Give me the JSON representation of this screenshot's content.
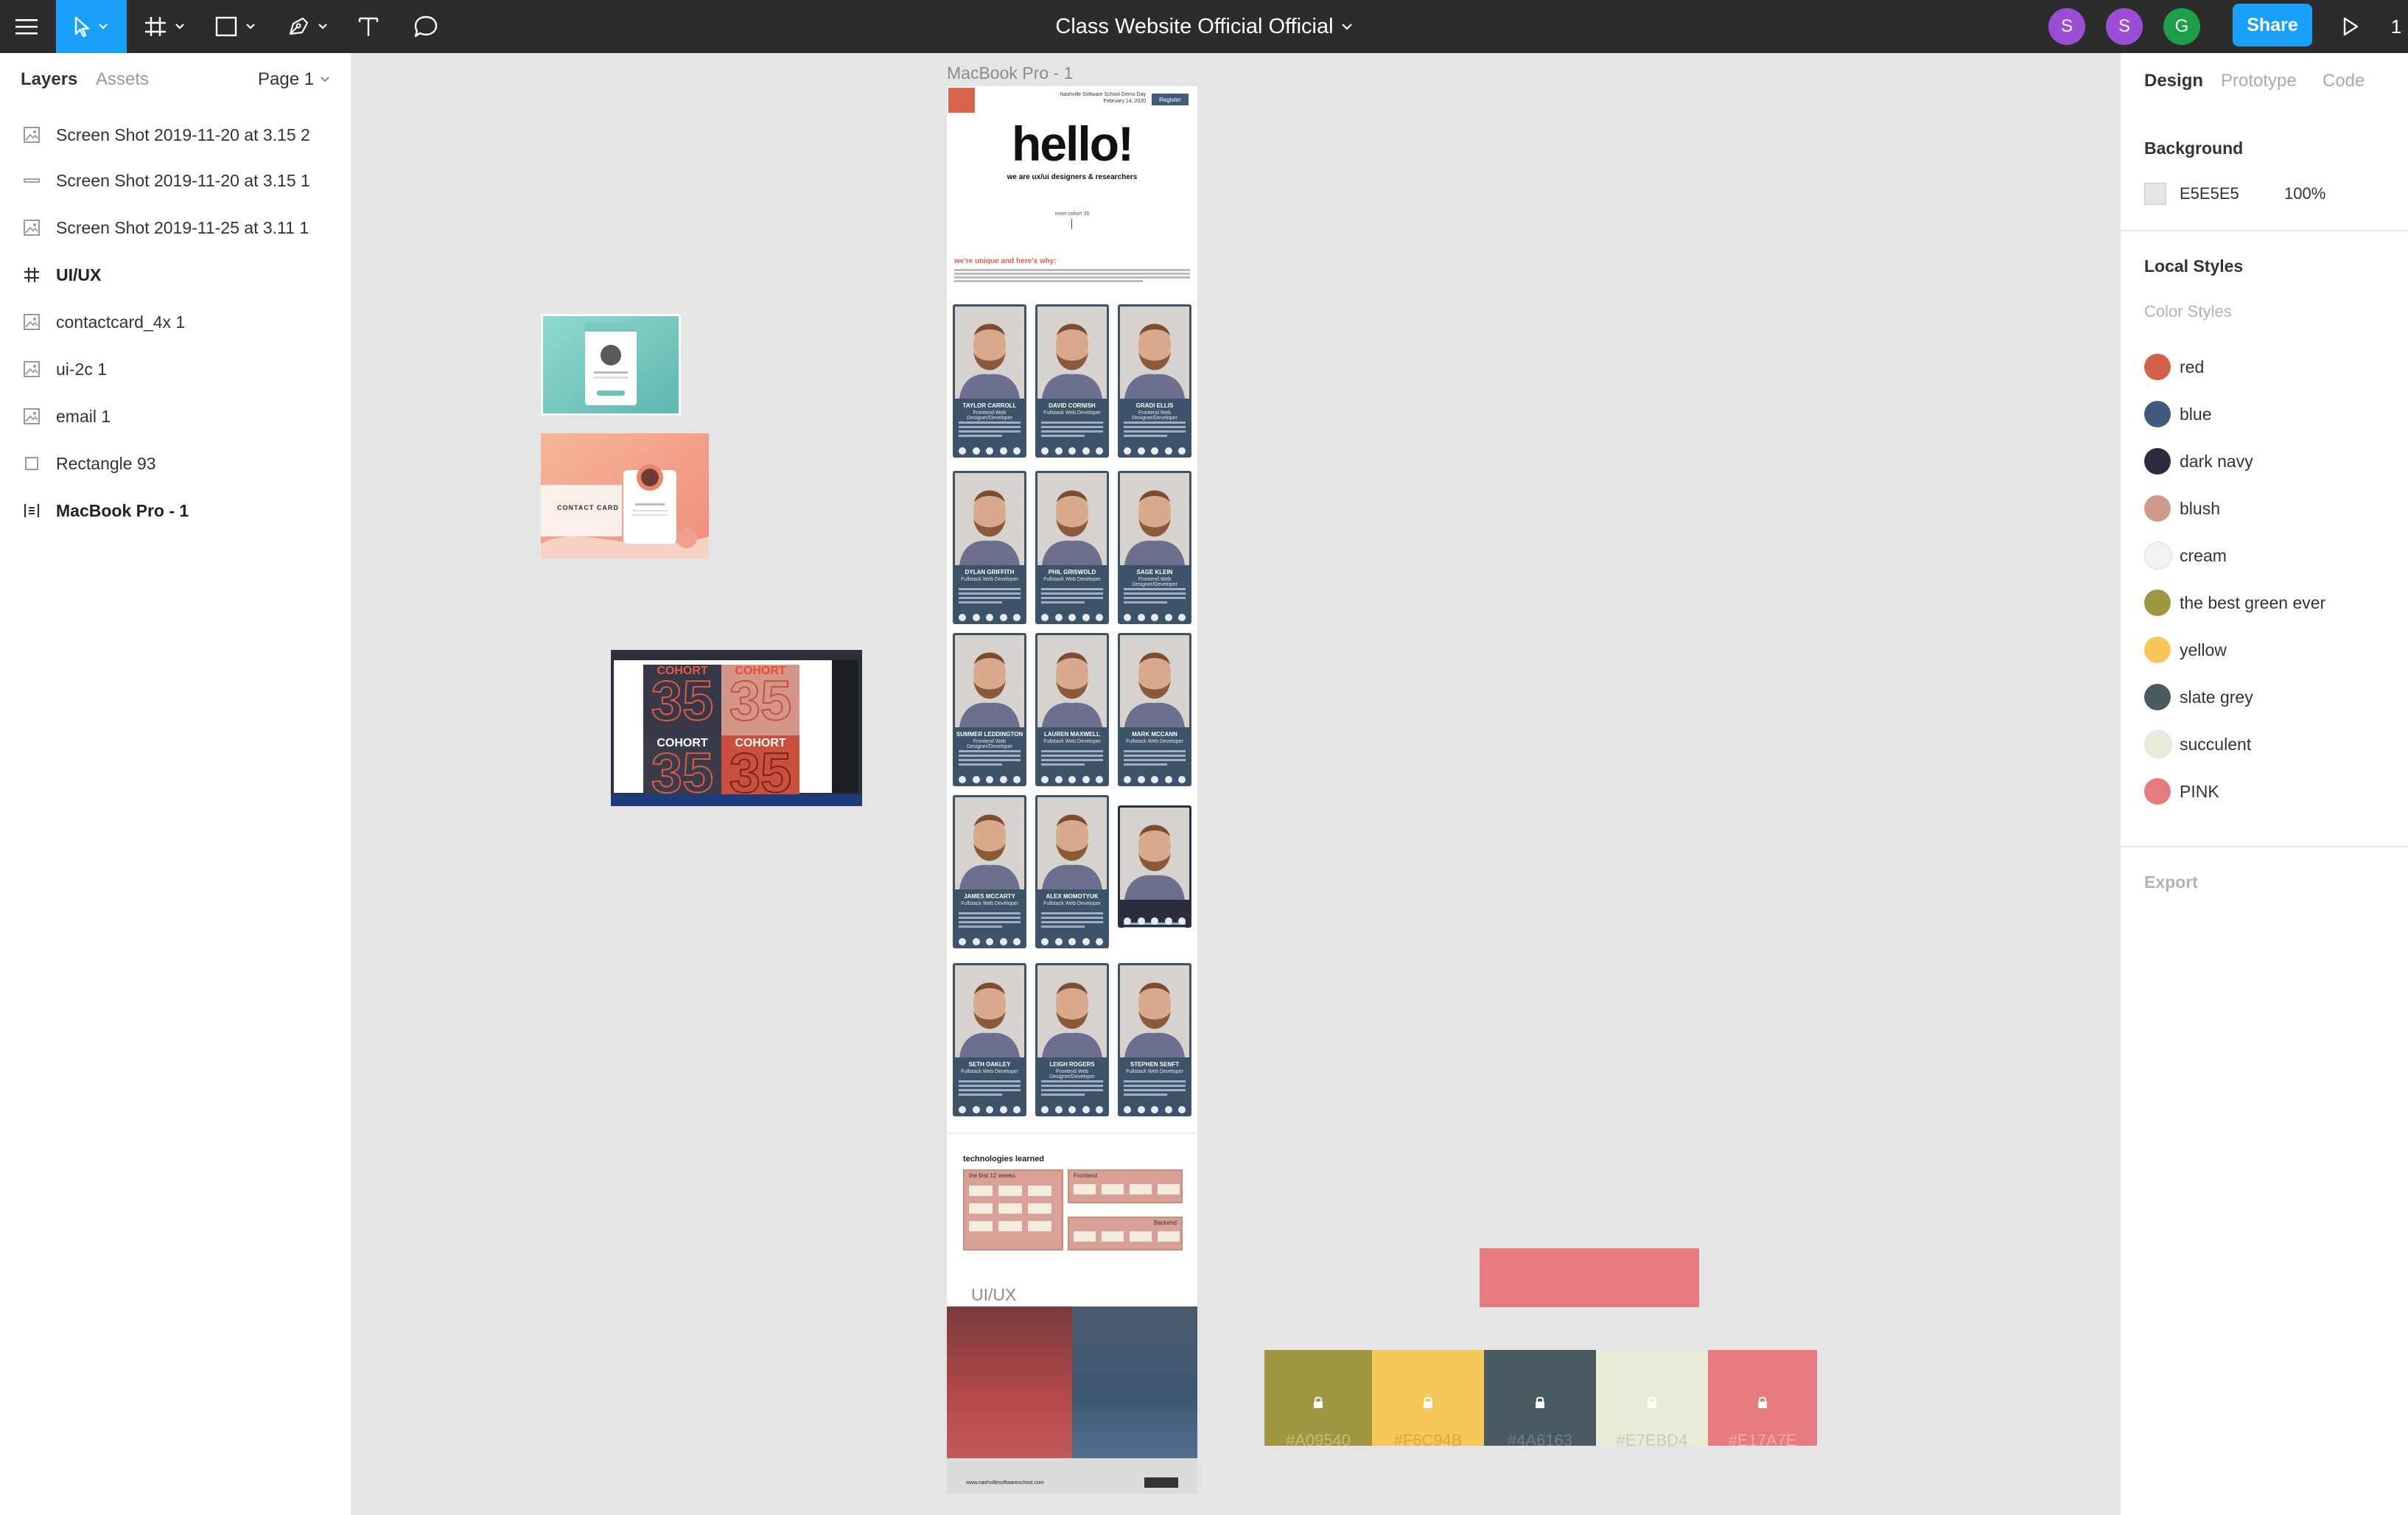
{
  "toolbar": {
    "menu_icon": "hamburger-icon",
    "tools": [
      "move-tool-icon",
      "frame-tool-icon",
      "shape-tool-icon",
      "pen-tool-icon",
      "text-tool-icon",
      "comment-tool-icon"
    ],
    "file_title": "Class Website Official Official",
    "avatars": [
      {
        "initial": "S",
        "color": "#9b4dd6"
      },
      {
        "initial": "S",
        "color": "#9b4dd6"
      },
      {
        "initial": "G",
        "color": "#1f9e4a"
      }
    ],
    "share_label": "Share",
    "share_color": "#18a0fb",
    "accent_color": "#18a0fb",
    "right_number": "1"
  },
  "left_panel": {
    "tabs": {
      "layers": "Layers",
      "assets": "Assets"
    },
    "page_selector": "Page 1",
    "layers": [
      {
        "label": "Screen Shot 2019-11-20 at 3.15 2",
        "icon": "image-icon"
      },
      {
        "label": "Screen Shot 2019-11-20 at 3.15 1",
        "icon": "line-icon"
      },
      {
        "label": "Screen Shot 2019-11-25 at 3.11 1",
        "icon": "image-icon"
      },
      {
        "label": "UI/UX",
        "icon": "frame-hash-icon"
      },
      {
        "label": "contactcard_4x 1",
        "icon": "image-icon"
      },
      {
        "label": "ui-2c 1",
        "icon": "image-icon"
      },
      {
        "label": "email 1",
        "icon": "image-icon"
      },
      {
        "label": "Rectangle 93",
        "icon": "rectangle-icon"
      },
      {
        "label": "MacBook Pro - 1",
        "icon": "frame-icon"
      }
    ]
  },
  "right_panel": {
    "tabs": {
      "design": "Design",
      "prototype": "Prototype",
      "code": "Code"
    },
    "background": {
      "heading": "Background",
      "hex": "E5E5E5",
      "opacity": "100%",
      "color": "#e5e5e5"
    },
    "local_styles": {
      "heading": "Local Styles",
      "subheading": "Color Styles",
      "styles": [
        {
          "name": "red",
          "color": "#d4604a"
        },
        {
          "name": "blue",
          "color": "#3f5a7c"
        },
        {
          "name": "dark navy",
          "color": "#2a2d3e"
        },
        {
          "name": "blush",
          "color": "#d09a8a"
        },
        {
          "name": "cream",
          "color": "#f2f2f2"
        },
        {
          "name": "the best green ever",
          "color": "#a09540"
        },
        {
          "name": "yellow",
          "color": "#f6c85a"
        },
        {
          "name": "slate grey",
          "color": "#4a5a60"
        },
        {
          "name": "succulent",
          "color": "#e8ecd8"
        },
        {
          "name": "PINK",
          "color": "#e57a7f"
        }
      ]
    },
    "export_label": "Export"
  },
  "canvas": {
    "frame_label": "MacBook Pro - 1",
    "uiux_label": "UI/UX",
    "website": {
      "header_line1": "Nashville Software School Demo Day",
      "header_line2": "February 14, 2020",
      "register": "Register",
      "hero": "hello!",
      "hero_sub": "we are ux/ui designers & researchers",
      "scroll_hint": "meet cohort 35",
      "unique_heading": "we're unique and here's why:",
      "cards": [
        {
          "name": "TAYLOR CARROLL",
          "role": "Frontend Web Designer/Developer"
        },
        {
          "name": "DAVID CORNISH",
          "role": "Fullstack Web Developer"
        },
        {
          "name": "GRADI ELLIS",
          "role": "Frontend Web Designer/Developer"
        },
        {
          "name": "DYLAN GRIFFITH",
          "role": "Fullstack Web Developer"
        },
        {
          "name": "PHIL GRISWOLD",
          "role": "Fullstack Web Developer"
        },
        {
          "name": "SAGE KLEIN",
          "role": "Frontend Web Designer/Developer"
        },
        {
          "name": "SUMMER LEDDINGTON",
          "role": "Frontend Web Designer/Developer"
        },
        {
          "name": "LAUREN MAXWELL",
          "role": "Fullstack Web Developer"
        },
        {
          "name": "MARK MCCANN",
          "role": "Fullstack Web Developer"
        },
        {
          "name": "JAMES MCCARTY",
          "role": "Fullstack Web Developer"
        },
        {
          "name": "ALEX MOMOTYUK",
          "role": "Fullstack Web Developer"
        },
        {
          "name": "",
          "role": ""
        },
        {
          "name": "SETH OAKLEY",
          "role": "Fullstack Web Developer"
        },
        {
          "name": "LEIGH ROGERS",
          "role": "Frontend Web Designer/Developer"
        },
        {
          "name": "STEPHEN SENFT",
          "role": "Fullstack Web Developer"
        }
      ],
      "tech_heading": "technologies learned",
      "tech_first": "the first 12 weeks:",
      "tech_frontend": "Frontend",
      "tech_backend": "Backend",
      "footer_url": "www.nashvillesoftwareschool.com"
    },
    "cohort_text": "COHORT",
    "cohort_number": "35",
    "contact_card_title": "CONTACT CARD",
    "palette": [
      {
        "hex": "#A09540",
        "color": "#a09540",
        "text": "#c7bd73"
      },
      {
        "hex": "#F6C94B",
        "color": "#f6c85a",
        "text": "#dca83c"
      },
      {
        "hex": "#4A6163",
        "color": "#4a5a60",
        "text": "#6c8286"
      },
      {
        "hex": "#E7EBD4",
        "color": "#e8ecd8",
        "text": "#c8ccb4"
      },
      {
        "hex": "#E17A7E",
        "color": "#e57a7f",
        "text": "#f2a8ab"
      }
    ]
  }
}
